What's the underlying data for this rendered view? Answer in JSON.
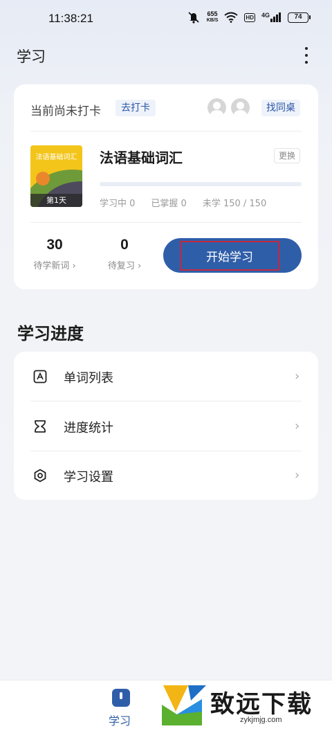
{
  "status_bar": {
    "time": "11:38:21",
    "speed_value": "655",
    "speed_unit": "KB/S",
    "hd": "HD",
    "network": "4G",
    "battery": "74"
  },
  "header": {
    "title": "学习"
  },
  "checkin": {
    "status": "当前尚未打卡",
    "go_checkin": "去打卡",
    "find_desk": "找同桌"
  },
  "book": {
    "cover_title": "法语基础词汇",
    "day_label": "第1天",
    "name": "法语基础词汇",
    "change": "更换",
    "progress": 0,
    "stats": {
      "learning": "学习中 0",
      "mastered": "已掌握 0",
      "unlearned": "未学 150 / 150"
    }
  },
  "counts": {
    "new_words": {
      "value": "30",
      "label": "待学新词 ›"
    },
    "review": {
      "value": "0",
      "label": "待复习 ›"
    }
  },
  "start_button": "开始学习",
  "progress_section": {
    "title": "学习进度",
    "items": [
      {
        "label": "单词列表",
        "icon": "word-list-icon"
      },
      {
        "label": "进度统计",
        "icon": "hourglass-icon"
      },
      {
        "label": "学习设置",
        "icon": "settings-hexagon-icon"
      }
    ]
  },
  "tabbar": {
    "active_label": "学习"
  },
  "watermark": {
    "text": "致远下载",
    "url": "zykjmjg.com"
  },
  "colors": {
    "accent": "#2f5ea9",
    "highlight": "#c6283d",
    "cover": "#f3c51a"
  }
}
